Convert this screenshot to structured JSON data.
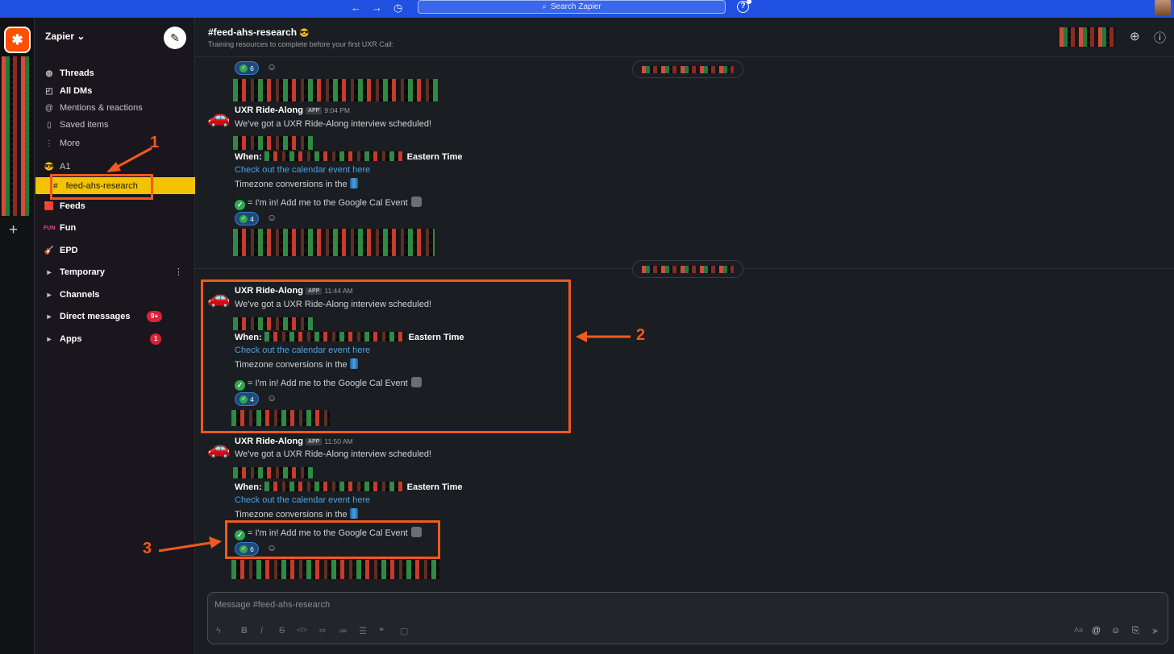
{
  "window": {
    "search_label": "Search Zapier",
    "help_label": "?"
  },
  "rail": {
    "add_label": "+"
  },
  "sidebar": {
    "workspace": "Zapier ⌄",
    "top_items": [
      {
        "icon": "threads-icon",
        "label": "Threads"
      },
      {
        "icon": "dm-icon",
        "label": "All DMs"
      },
      {
        "icon": "at-icon",
        "label": "Mentions & reactions"
      },
      {
        "icon": "bookmark-icon",
        "label": "Saved items"
      },
      {
        "icon": "more-icon",
        "label": "More"
      }
    ],
    "section_a1": "A1",
    "active_channel": "feed-ahs-research",
    "sections": [
      "Feeds",
      "Fun",
      "EPD",
      "Temporary",
      "Channels",
      "Direct messages",
      "Apps"
    ],
    "dm_badge": "9+",
    "apps_badge": "1"
  },
  "channel": {
    "name": "#feed-ahs-research",
    "topic": "Training resources to complete before your first UXR Call:"
  },
  "messages": [
    {
      "sender": "UXR Ride-Along",
      "tag": "APP",
      "time": "9:04 PM",
      "text": "We've got a UXR Ride-Along interview scheduled!",
      "when_label": "When:",
      "timezone": "Eastern Time",
      "link": "Check out the calendar event here",
      "tz_line": "Timezone conversions in the",
      "rsvp": "= I'm in! Add me to the Google Cal Event",
      "reaction_count": "4"
    },
    {
      "sender": "UXR Ride-Along",
      "tag": "APP",
      "time": "11:44 AM",
      "text": "We've got a UXR Ride-Along interview scheduled!",
      "when_label": "When:",
      "timezone": "Eastern Time",
      "link": "Check out the calendar event here",
      "tz_line": "Timezone conversions in the",
      "rsvp": "= I'm in! Add me to the Google Cal Event",
      "reaction_count": "4"
    },
    {
      "sender": "UXR Ride-Along",
      "tag": "APP",
      "time": "11:50 AM",
      "text": "We've got a UXR Ride-Along interview scheduled!",
      "when_label": "When:",
      "timezone": "Eastern Time",
      "link": "Check out the calendar event here",
      "tz_line": "Timezone conversions in the",
      "rsvp": "= I'm in! Add me to the Google Cal Event",
      "reaction_count": "6"
    }
  ],
  "top_reaction_count": "6",
  "annotations": [
    "1",
    "2",
    "3"
  ],
  "composer": {
    "placeholder": "Message #feed-ahs-research"
  },
  "colors": {
    "accent_blue": "#2050e0",
    "active_channel": "#f2c300",
    "annotation": "#f05a1e",
    "link": "#4aa3e8"
  }
}
